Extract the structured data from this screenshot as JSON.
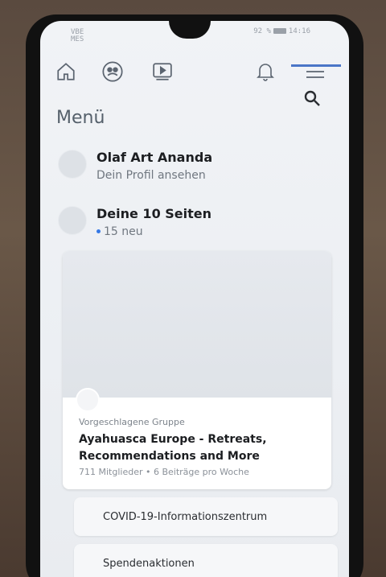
{
  "status": {
    "carrier_line1": "VBE",
    "carrier_line2": "MES",
    "battery": "92 %",
    "time": "14:16"
  },
  "nav": {
    "items": [
      "home",
      "groups",
      "watch",
      "notifications",
      "menu"
    ]
  },
  "menu": {
    "title": "Menü",
    "profile": {
      "name": "Olaf Art Ananda",
      "sub": "Dein Profil ansehen"
    },
    "pages": {
      "title": "Deine 10 Seiten",
      "sub": "15 neu"
    },
    "suggestion": {
      "kicker": "Vorgeschlagene Gruppe",
      "title": "Ayahuasca Europe - Retreats, Recommendations and More",
      "meta": "711 Mitglieder • 6 Beiträge pro Woche"
    },
    "covid": "COVID-19-Informationszentrum",
    "fundraisers": "Spendenaktionen"
  },
  "colors": {
    "accent": "#4a75c7",
    "new_dot": "#3578e5"
  }
}
